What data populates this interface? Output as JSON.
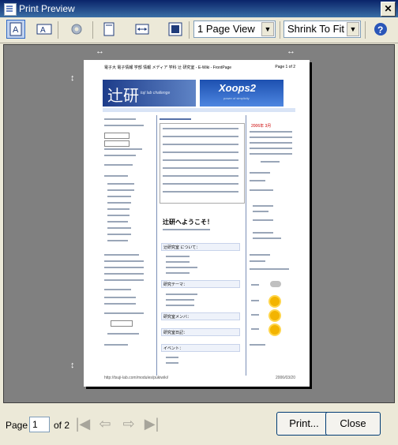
{
  "window": {
    "title": "Print Preview",
    "close_glyph": "✕"
  },
  "toolbar": {
    "view_mode": "1 Page View",
    "scale": "Shrink To Fit",
    "help_glyph": "?",
    "icons": [
      "portrait-icon",
      "landscape-icon",
      "page-setup-icon",
      "full-page-icon",
      "fit-width-icon",
      "fit-height-icon",
      "help-icon"
    ]
  },
  "page_preview": {
    "header_left": "電子大 電子情報 学部 情報 メディア 学科 辻 研究室 - E-Wiki - FrontPage",
    "header_right": "Page 1 of 2",
    "banner_left_text": "辻研",
    "banner_left_sub": "tuji lab challenge",
    "banner_right_text": "Xoops2",
    "banner_right_sub": "power of simplicity",
    "welcome_title": "辻研へようこそ！",
    "sections": [
      "辻研究室 について：",
      "研究テーマ：",
      "研究室メンバ：",
      "研究室日記：",
      "イベント："
    ],
    "calendar_title": "2006年 3月",
    "footer_left": "http://tsuji-lab.com/modules/pukiwiki/",
    "footer_right": "2006/03/20"
  },
  "bottom": {
    "page_label": "Page",
    "page_value": "1",
    "of_label": "of 2",
    "print_label": "Print...",
    "close_label": "Close",
    "first_glyph": "|◀",
    "prev_glyph": "⇦",
    "next_glyph": "⇨",
    "last_glyph": "▶|"
  }
}
